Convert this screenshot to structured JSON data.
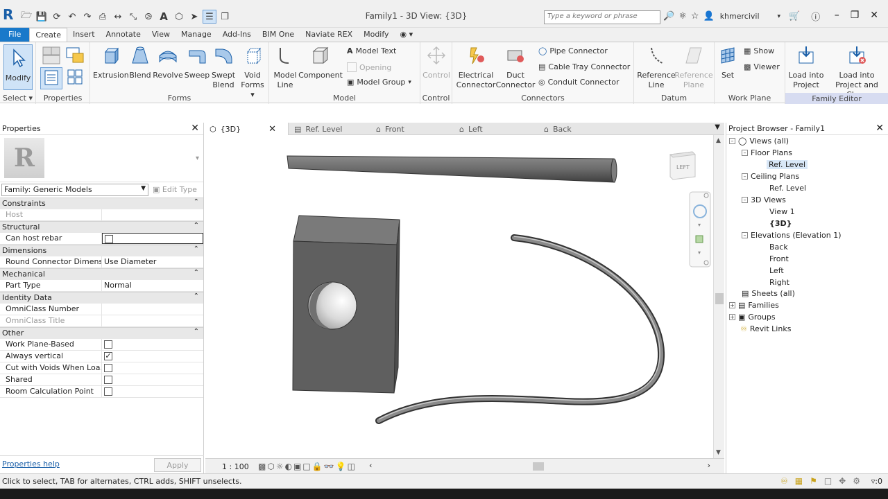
{
  "app": {
    "title": "Family1 - 3D View: {3D}",
    "logo": "R",
    "search_placeholder": "Type a keyword or phrase",
    "user": "khmercivil"
  },
  "tabs": [
    "File",
    "Create",
    "Insert",
    "Annotate",
    "View",
    "Manage",
    "Add-Ins",
    "BIM One",
    "Naviate REX",
    "Modify"
  ],
  "ribbon": {
    "select": {
      "modify": "Modify",
      "label": "Select"
    },
    "properties": {
      "label": "Properties"
    },
    "forms": {
      "label": "Forms",
      "extrusion": "Extrusion",
      "blend": "Blend",
      "revolve": "Revolve",
      "sweep": "Sweep",
      "swept_blend_1": "Swept",
      "swept_blend_2": "Blend",
      "void_1": "Void",
      "void_2": "Forms"
    },
    "model": {
      "label": "Model",
      "model_line_1": "Model",
      "model_line_2": "Line",
      "component": "Component",
      "model_text": "Model  Text",
      "opening": "Opening",
      "model_group": "Model  Group"
    },
    "control": {
      "label": "Control",
      "control": "Control"
    },
    "connectors": {
      "label": "Connectors",
      "electrical_1": "Electrical",
      "electrical_2": "Connector",
      "duct_1": "Duct",
      "duct_2": "Connector",
      "pipe": "Pipe  Connector",
      "cable_tray": "Cable Tray  Connector",
      "conduit": "Conduit  Connector"
    },
    "datum": {
      "label": "Datum",
      "ref_line_1": "Reference",
      "ref_line_2": "Line",
      "ref_plane_1": "Reference",
      "ref_plane_2": "Plane"
    },
    "work_plane": {
      "label": "Work Plane",
      "set": "Set",
      "show": "Show",
      "viewer": "Viewer"
    },
    "family_editor": {
      "label": "Family Editor",
      "load_1": "Load into",
      "load_2": "Project",
      "load_close_1": "Load into",
      "load_close_2": "Project and Close"
    }
  },
  "properties": {
    "title": "Properties",
    "family": "Family: Generic Models",
    "edit_type": "Edit Type",
    "sections": {
      "constraints": "Constraints",
      "structural": "Structural",
      "dimensions": "Dimensions",
      "mechanical": "Mechanical",
      "identity": "Identity Data",
      "other": "Other"
    },
    "rows": {
      "host": "Host",
      "can_host_rebar": "Can host rebar",
      "round_connector": "Round Connector Dimens...",
      "round_connector_val": "Use Diameter",
      "part_type": "Part Type",
      "part_type_val": "Normal",
      "omniclass_number": "OmniClass Number",
      "omniclass_title": "OmniClass Title",
      "work_plane_based": "Work Plane-Based",
      "always_vertical": "Always vertical",
      "cut_with_voids": "Cut with Voids When Loa...",
      "shared": "Shared",
      "room_calc": "Room Calculation Point"
    },
    "help": "Properties help",
    "apply": "Apply"
  },
  "view_tabs": [
    "{3D}",
    "Ref. Level",
    "Front",
    "Left",
    "Back"
  ],
  "viewcube_label": "LEFT",
  "view_control": {
    "scale": "1 : 100"
  },
  "browser": {
    "title": "Project Browser - Family1",
    "nodes": {
      "views": "Views (all)",
      "floor_plans": "Floor Plans",
      "fp_ref": "Ref. Level",
      "ceiling_plans": "Ceiling Plans",
      "cp_ref": "Ref. Level",
      "views_3d": "3D Views",
      "view1": "View 1",
      "v3d": "{3D}",
      "elevations": "Elevations (Elevation 1)",
      "back": "Back",
      "front": "Front",
      "left": "Left",
      "right": "Right",
      "sheets": "Sheets (all)",
      "families": "Families",
      "groups": "Groups",
      "links": "Revit Links"
    }
  },
  "status": {
    "text": "Click to select, TAB for alternates, CTRL adds, SHIFT unselects.",
    "filter": ":0"
  }
}
